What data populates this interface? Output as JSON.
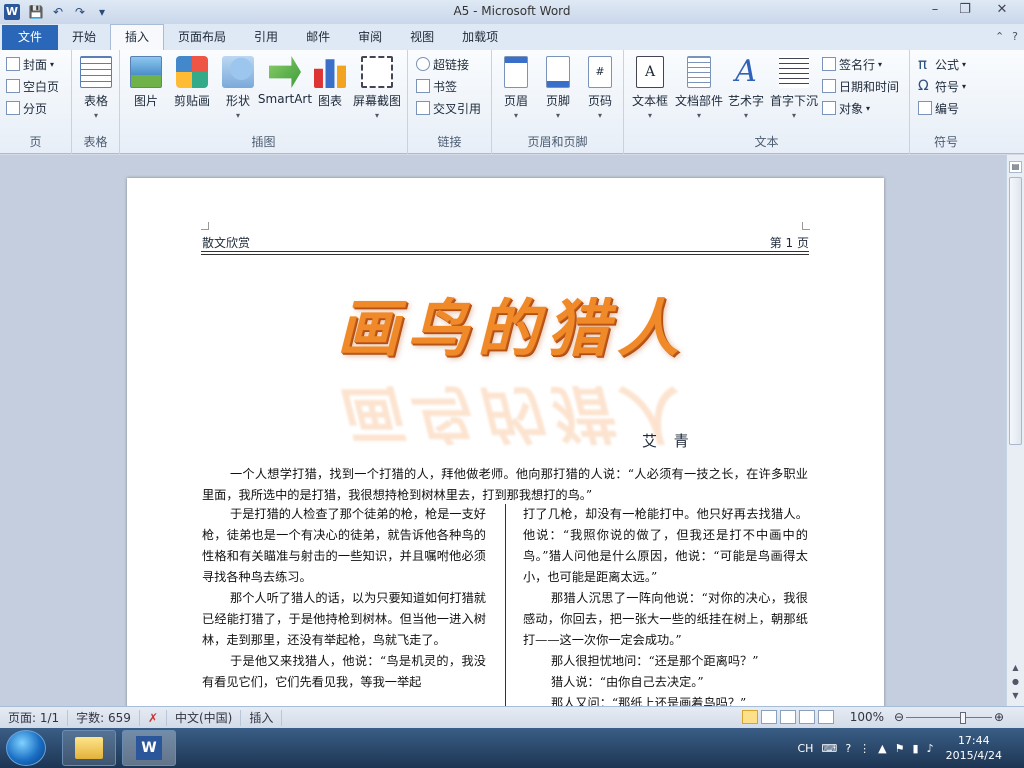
{
  "window": {
    "title": "A5  -  Microsoft Word",
    "app_icon_letter": "W",
    "minimize": "–",
    "restore": "❐",
    "close": "✕"
  },
  "qat": {
    "save": "💾",
    "undo": "↶",
    "redo": "↷",
    "customize": "▾"
  },
  "tabs": {
    "file": "文件",
    "items": [
      "开始",
      "插入",
      "页面布局",
      "引用",
      "邮件",
      "审阅",
      "视图",
      "加载项"
    ],
    "active": "插入",
    "help": "?"
  },
  "ribbon": {
    "pages": {
      "label": "页",
      "cover": "封面",
      "blank": "空白页",
      "break": "分页"
    },
    "tables": {
      "label": "表格",
      "table": "表格"
    },
    "illustrations": {
      "label": "插图",
      "picture": "图片",
      "clipart": "剪贴画",
      "shapes": "形状",
      "smartart": "SmartArt",
      "chart": "图表",
      "screenshot": "屏幕截图"
    },
    "links": {
      "label": "链接",
      "hyperlink": "超链接",
      "bookmark": "书签",
      "crossref": "交叉引用"
    },
    "header_footer": {
      "label": "页眉和页脚",
      "header": "页眉",
      "footer": "页脚",
      "page_number": "页码"
    },
    "text": {
      "label": "文本",
      "textbox": "文本框",
      "quickparts": "文档部件",
      "wordart": "艺术字",
      "dropcap": "首字下沉",
      "signature": "签名行",
      "datetime": "日期和时间",
      "object": "对象"
    },
    "symbols": {
      "label": "符号",
      "equation": "公式",
      "symbol": "符号",
      "number": "编号"
    }
  },
  "document": {
    "header_left": "散文欣赏",
    "header_right": "第 1 页",
    "wordart_title": "画鸟的猎人",
    "author": "艾  青",
    "intro": "一个人想学打猎，找到一个打猎的人，拜他做老师。他向那打猎的人说：“人必须有一技之长，在许多职业里面，我所选中的是打猎，我很想持枪到树林里去，打到那我想打的鸟。”",
    "left_col": [
      "于是打猎的人检查了那个徒弟的枪，枪是一支好枪，徒弟也是一个有决心的徒弟，就告诉他各种鸟的性格和有关瞄准与射击的一些知识，并且嘱咐他必须寻找各种鸟去练习。",
      "那个人听了猎人的话，以为只要知道如何打猎就已经能打猎了，于是他持枪到树林。但当他一进入树林，走到那里，还没有举起枪，鸟就飞走了。",
      "于是他又来找猎人，他说：“鸟是机灵的，我没有看见它们，它们先看见我，等我一举起"
    ],
    "right_col": [
      "打了几枪，却没有一枪能打中。他只好再去找猎人。他说：“我照你说的做了，但我还是打不中画中的鸟。”猎人问他是什么原因，他说：“可能是鸟画得太小，也可能是距离太远。”",
      "那猎人沉思了一阵向他说：“对你的决心，我很感动，你回去，把一张大一些的纸挂在树上，朝那纸打——这一次你一定会成功。”",
      "那人很担忧地问：“还是那个距离吗？”",
      "猎人说：“由你自己去决定。”",
      "那人又问：“那纸上还是画着鸟吗？”"
    ]
  },
  "status": {
    "page": "页面: 1/1",
    "words": "字数: 659",
    "language": "中文(中国)",
    "mode": "插入",
    "zoom": "100%",
    "zoom_level": 1.0
  },
  "taskbar": {
    "ime": "CH",
    "time": "17:44",
    "date": "2015/4/24"
  }
}
